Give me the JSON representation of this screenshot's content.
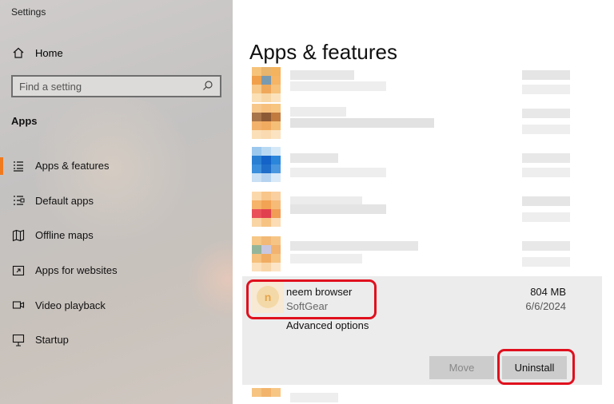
{
  "window": {
    "title": "Settings"
  },
  "sidebar": {
    "home_label": "Home",
    "search_placeholder": "Find a setting",
    "section_title": "Apps",
    "items": [
      {
        "label": "Apps & features",
        "icon": "apps-features-icon",
        "active": true
      },
      {
        "label": "Default apps",
        "icon": "default-apps-icon"
      },
      {
        "label": "Offline maps",
        "icon": "map-icon"
      },
      {
        "label": "Apps for websites",
        "icon": "apps-websites-icon"
      },
      {
        "label": "Video playback",
        "icon": "video-icon"
      },
      {
        "label": "Startup",
        "icon": "startup-icon"
      }
    ]
  },
  "main": {
    "title": "Apps & features",
    "selected_app": {
      "name": "neem browser",
      "publisher": "SoftGear",
      "size": "804 MB",
      "date": "6/6/2024",
      "advanced_label": "Advanced options",
      "move_label": "Move",
      "uninstall_label": "Uninstall"
    }
  },
  "colors": {
    "accent": "#f07b1f",
    "highlight": "#e0101e"
  }
}
